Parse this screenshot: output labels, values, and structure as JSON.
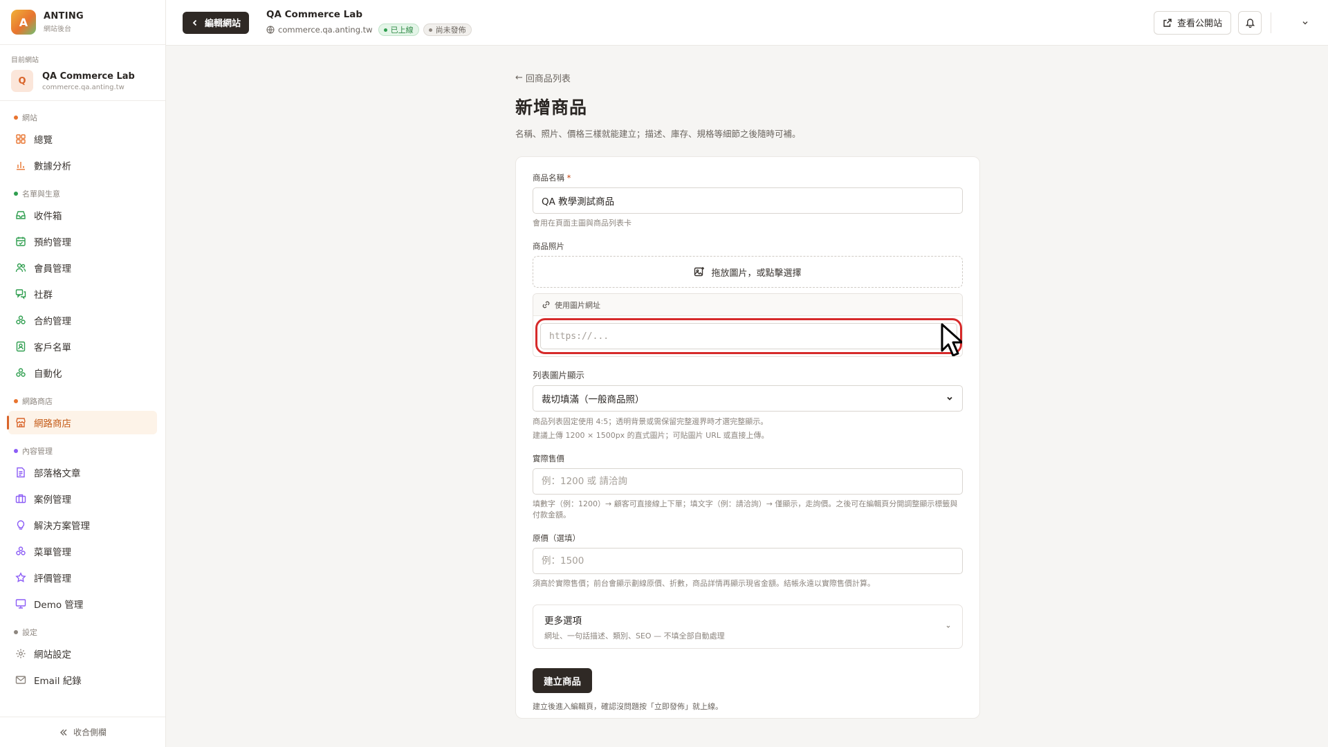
{
  "brand": {
    "logo_letter": "A",
    "name": "ANTING",
    "subtitle": "網站後台"
  },
  "current_site": {
    "caption": "目前網站",
    "avatar_letter": "Q",
    "name": "QA Commerce Lab",
    "domain": "commerce.qa.anting.tw"
  },
  "sidebar": {
    "groups": [
      {
        "title": "網站",
        "dot_color": "#e8742f",
        "items": [
          {
            "label": "總覽",
            "icon": "grid-icon"
          },
          {
            "label": "數據分析",
            "icon": "bar-chart-icon"
          }
        ]
      },
      {
        "title": "名單與生意",
        "dot_color": "#2f9e4f",
        "items": [
          {
            "label": "收件箱",
            "icon": "inbox-icon"
          },
          {
            "label": "預約管理",
            "icon": "calendar-icon"
          },
          {
            "label": "會員管理",
            "icon": "users-icon"
          },
          {
            "label": "社群",
            "icon": "chat-icon"
          },
          {
            "label": "合約管理",
            "icon": "cluster-icon"
          },
          {
            "label": "客戶名單",
            "icon": "contact-icon"
          },
          {
            "label": "自動化",
            "icon": "cluster-icon"
          }
        ]
      },
      {
        "title": "網路商店",
        "dot_color": "#e8742f",
        "items": [
          {
            "label": "網路商店",
            "icon": "store-icon",
            "active": true
          }
        ]
      },
      {
        "title": "內容管理",
        "dot_color": "#8b5cf6",
        "items": [
          {
            "label": "部落格文章",
            "icon": "document-icon"
          },
          {
            "label": "案例管理",
            "icon": "briefcase-icon"
          },
          {
            "label": "解決方案管理",
            "icon": "lightbulb-icon"
          },
          {
            "label": "菜單管理",
            "icon": "cluster-icon"
          },
          {
            "label": "評價管理",
            "icon": "star-icon"
          },
          {
            "label": "Demo 管理",
            "icon": "presentation-icon"
          }
        ]
      },
      {
        "title": "設定",
        "dot_color": "#8d867f",
        "items": [
          {
            "label": "網站設定",
            "icon": "gear-icon"
          },
          {
            "label": "Email 紀錄",
            "icon": "mail-icon"
          }
        ]
      }
    ],
    "collapse_label": "收合側欄"
  },
  "topbar": {
    "back_label": "編輯網站",
    "site_title": "QA Commerce Lab",
    "site_domain": "commerce.qa.anting.tw",
    "badge_live": "已上線",
    "badge_draft": "尚未發佈",
    "view_site_label": "查看公開站"
  },
  "page": {
    "back_link": "回商品列表",
    "title": "新增商品",
    "description": "名稱、照片、價格三樣就能建立；描述、庫存、規格等細節之後隨時可補。"
  },
  "form": {
    "name": {
      "label": "商品名稱",
      "required_mark": "*",
      "value": "QA 教學測試商品",
      "hint": "會用在頁面主圖與商品列表卡"
    },
    "photo": {
      "label": "商品照片",
      "dropzone_text": "拖放圖片，或點擊選擇",
      "url_toggle_label": "使用圖片網址",
      "url_placeholder": "https://..."
    },
    "list_display": {
      "label": "列表圖片顯示",
      "selected": "裁切填滿（一般商品照）",
      "hint_line1": "商品列表固定使用 4:5；透明背景或需保留完整邊界時才選完整顯示。",
      "hint_line2": "建議上傳 1200 × 1500px 的直式圖片；可貼圖片 URL 或直接上傳。"
    },
    "price": {
      "label": "實際售價",
      "placeholder": "例：1200 或 請洽詢",
      "hint": "填數字（例：1200）→ 顧客可直接線上下單；填文字（例：請洽詢）→ 僅顯示，走詢價。之後可在編輯頁分開調整顯示標籤與付款金額。"
    },
    "original_price": {
      "label": "原價（選填）",
      "placeholder": "例：1500",
      "hint": "須高於實際售價；前台會顯示劃線原價、折數，商品詳情再顯示現省金額。結帳永遠以實際售價計算。"
    },
    "more_options": {
      "title": "更多選項",
      "subtitle": "網址、一句話描述、類別、SEO — 不填全部自動處理"
    },
    "submit_label": "建立商品",
    "final_note": "建立後進入編輯頁，確認沒問題按「立即發佈」就上線。"
  }
}
